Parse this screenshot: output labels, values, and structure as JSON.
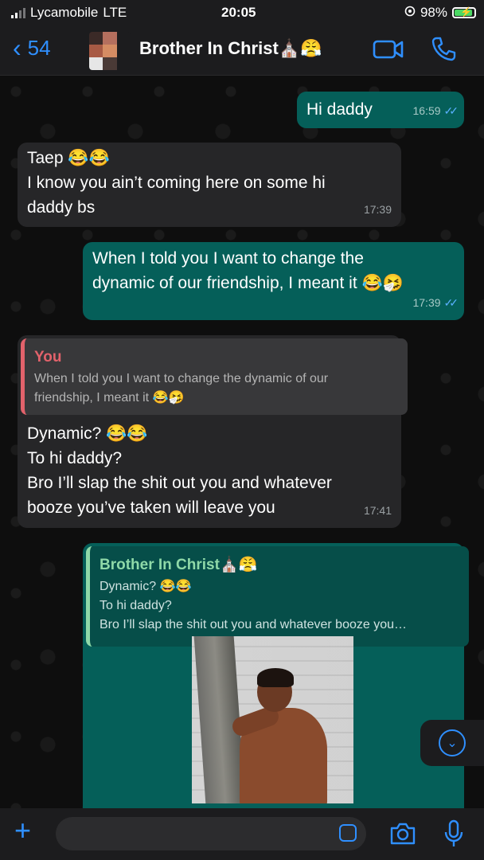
{
  "status": {
    "carrier": "Lycamobile",
    "network": "LTE",
    "time": "20:05",
    "battery": "98%"
  },
  "header": {
    "back_count": "54",
    "contact_name": "Brother In Christ⛪😤"
  },
  "messages": [
    {
      "text": "Hi daddy",
      "time": "16:59"
    },
    {
      "lines": [
        "Taep 😂😂",
        "I know you ain’t coming here on some hi",
        "daddy bs"
      ],
      "time": "17:39"
    },
    {
      "lines": [
        "When I told you I want to change the",
        "dynamic of our friendship, I meant it 😂🤧"
      ],
      "time": "17:39"
    },
    {
      "quote": {
        "name": "You",
        "lines": [
          "When I told you I want to change the dynamic of our",
          "friendship, I meant it 😂🤧"
        ]
      },
      "lines": [
        "Dynamic? 😂😂",
        "To hi daddy?",
        "Bro I’ll slap the shit out you and whatever",
        "booze you’ve taken will leave you"
      ],
      "time": "17:41"
    },
    {
      "quote": {
        "name": "Brother In Christ⛪😤",
        "lines": [
          "Dynamic? 😂😂",
          "To hi daddy?",
          "Bro I’ll slap the shit out you and whatever booze you…"
        ]
      }
    }
  ],
  "icons": [
    "signal-icon",
    "battery-icon",
    "video-call-icon",
    "phone-icon",
    "scroll-down-icon",
    "plus-icon",
    "sticker-icon",
    "camera-icon",
    "microphone-icon"
  ],
  "colors": {
    "incoming": "#262628",
    "outgoing": "#055f59",
    "accent": "#2f8fff",
    "quote_you": "#e2626b",
    "quote_contact": "#8fd9a8"
  }
}
